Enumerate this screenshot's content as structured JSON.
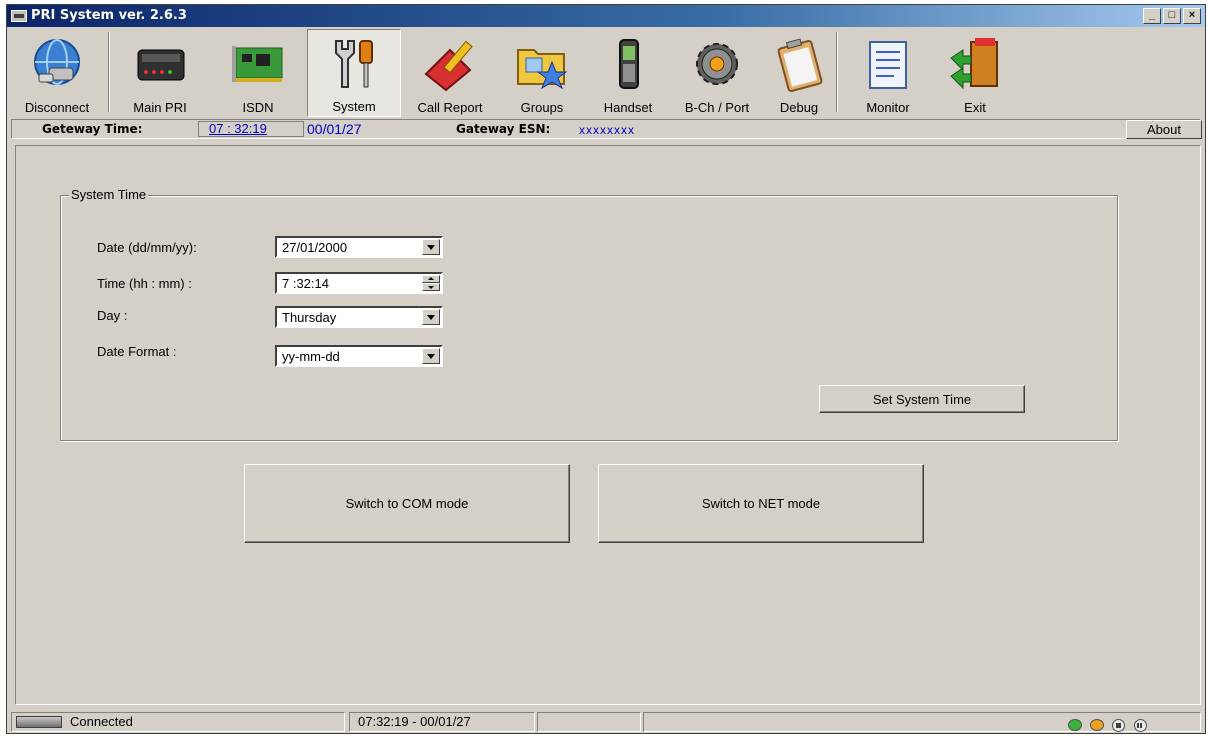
{
  "window": {
    "title": "PRI System ver. 2.6.3",
    "controls": [
      "_",
      "□",
      "×"
    ]
  },
  "toolbar": {
    "items": [
      {
        "label": "Disconnect",
        "icon": "disconnect-globe-icon"
      },
      {
        "label": "Main PRI",
        "icon": "router-device-icon"
      },
      {
        "label": "ISDN",
        "icon": "isdn-card-icon"
      },
      {
        "label": "System",
        "icon": "wrench-screwdriver-icon",
        "active": true
      },
      {
        "label": "Call Report",
        "icon": "call-report-icon"
      },
      {
        "label": "Groups",
        "icon": "groups-folder-icon"
      },
      {
        "label": "Handset",
        "icon": "handset-phone-icon"
      },
      {
        "label": "B-Ch / Port",
        "icon": "gear-icon"
      },
      {
        "label": "Debug",
        "icon": "clipboard-icon"
      },
      {
        "label": "Monitor",
        "icon": "monitor-document-icon"
      },
      {
        "label": "Exit",
        "icon": "exit-door-icon"
      }
    ]
  },
  "infobar": {
    "gateway_time_label": "Geteway Time:",
    "gateway_time": "07 : 32:19",
    "gateway_date": "00/01/27",
    "esn_label": "Gateway ESN:",
    "esn_value": "xxxxxxxx",
    "about_label": "About"
  },
  "system_time": {
    "legend": "System Time",
    "date_label": "Date (dd/mm/yy):",
    "date_value": "27/01/2000",
    "time_label": "Time (hh : mm) :",
    "time_value": "7 :32:14",
    "day_label": "Day :",
    "day_value": "Thursday",
    "format_label": "Date Format :",
    "format_value": "yy-mm-dd",
    "set_button": "Set System Time"
  },
  "mode_buttons": {
    "com": "Switch to COM mode",
    "net": "Switch to NET mode"
  },
  "statusbar": {
    "connection": "Connected",
    "timestamp": "07:32:19 - 00/01/27",
    "led_colors": [
      "#3cb43c",
      "#f0a020"
    ]
  }
}
